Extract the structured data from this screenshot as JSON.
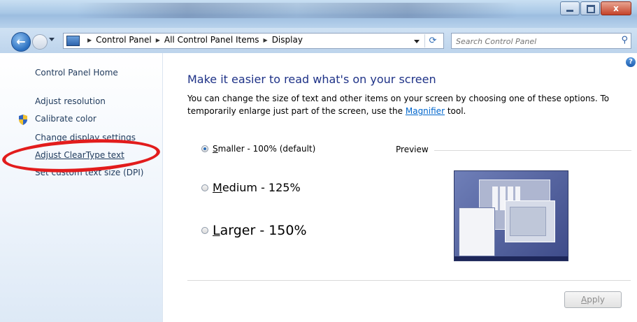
{
  "window": {
    "buttons": {
      "close_label": "x"
    }
  },
  "address": {
    "crumbs": [
      "Control Panel",
      "All Control Panel Items",
      "Display"
    ]
  },
  "search": {
    "placeholder": "Search Control Panel"
  },
  "sidebar": {
    "items": [
      {
        "label": "Control Panel Home"
      },
      {
        "label": "Adjust resolution"
      },
      {
        "label": "Calibrate color"
      },
      {
        "label": "Change display settings"
      },
      {
        "label": "Adjust ClearType text"
      },
      {
        "label": "Set custom text size (DPI)"
      }
    ],
    "highlight_color": "#e21c1c"
  },
  "main": {
    "heading": "Make it easier to read what's on your screen",
    "desc_part1": "You can change the size of text and other items on your screen by choosing one of these options. To temporarily enlarge just part of the screen, use the ",
    "magnifier_link": "Magnifier",
    "desc_part2": " tool.",
    "options": [
      {
        "access": "S",
        "rest": "maller - 100% (default)",
        "selected": true
      },
      {
        "access": "M",
        "rest": "edium - 125%",
        "selected": false
      },
      {
        "access": "L",
        "rest": "arger - 150%",
        "selected": false
      }
    ],
    "preview_label": "Preview",
    "apply_access": "A",
    "apply_rest": "pply"
  },
  "icons": {
    "back": "back-arrow-icon",
    "forward": "forward-arrow-icon",
    "search": "magnifier-icon",
    "refresh": "refresh-icon",
    "help": "help-icon",
    "shield": "uac-shield-icon"
  },
  "colors": {
    "link": "#0066cc",
    "heading": "#1e3287",
    "sidebar_text": "#1e395b"
  }
}
